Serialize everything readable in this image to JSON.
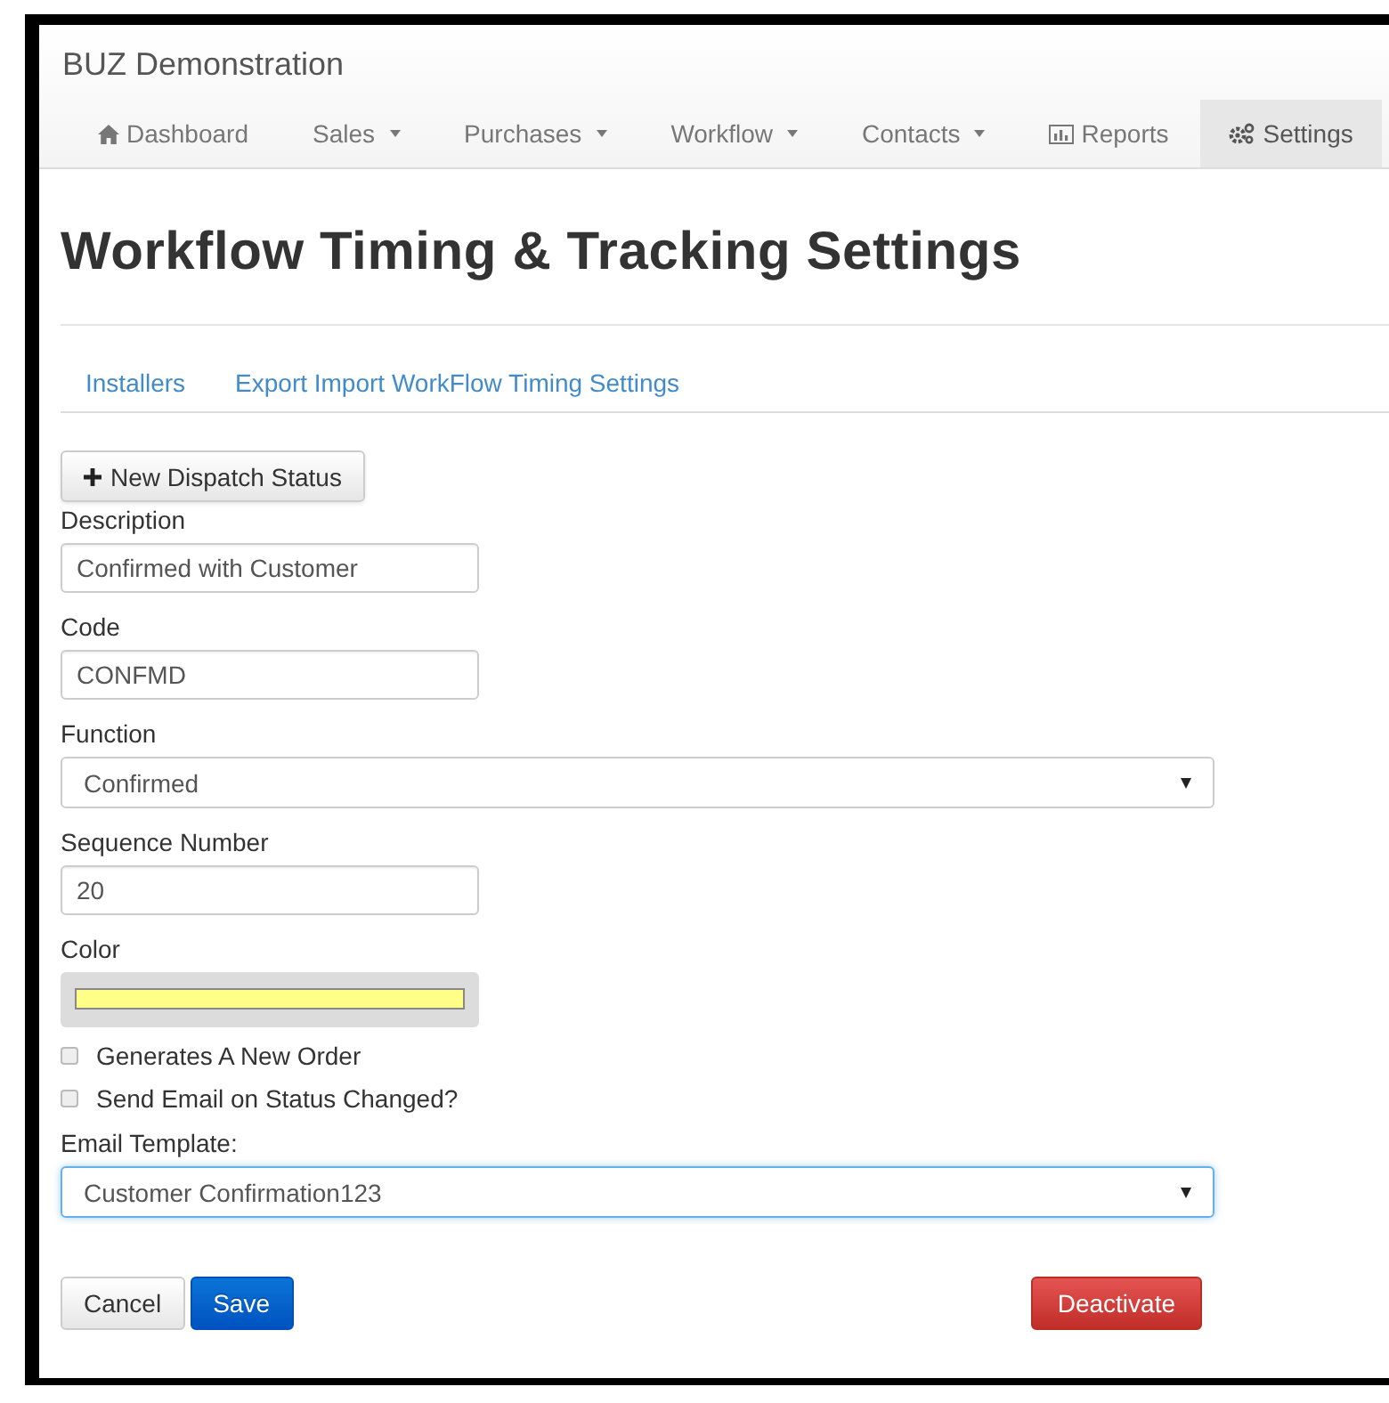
{
  "brand": "BUZ Demonstration",
  "nav": [
    {
      "label": "Dashboard",
      "kind": "home",
      "dropdown": false,
      "selected": false
    },
    {
      "label": "Sales",
      "dropdown": true,
      "selected": false
    },
    {
      "label": "Purchases",
      "dropdown": true,
      "selected": false
    },
    {
      "label": "Workflow",
      "dropdown": true,
      "selected": false
    },
    {
      "label": "Contacts",
      "dropdown": true,
      "selected": false
    },
    {
      "label": "Reports",
      "kind": "chart",
      "dropdown": false,
      "selected": false
    },
    {
      "label": "Settings",
      "kind": "gears",
      "dropdown": false,
      "selected": true
    }
  ],
  "title": "Workflow Timing & Tracking Settings",
  "links": [
    "Installers",
    "Export Import WorkFlow Timing Settings"
  ],
  "new_button": "New Dispatch Status",
  "fields": [
    {
      "kind": "text",
      "label": "Description",
      "value": "Confirmed with Customer"
    },
    {
      "kind": "text",
      "label": "Code",
      "value": "CONFMD"
    },
    {
      "kind": "select",
      "label": "Function",
      "value": "Confirmed",
      "focused": false
    },
    {
      "kind": "text",
      "label": "Sequence Number",
      "value": "20"
    },
    {
      "kind": "color",
      "label": "Color",
      "color": "#ffff88"
    },
    {
      "kind": "checkbox",
      "label": "Generates A New Order",
      "checked": false
    },
    {
      "kind": "checkbox",
      "label": "Send Email on Status Changed?",
      "checked": false
    },
    {
      "kind": "select",
      "label": "Email Template:",
      "value": "Customer Confirmation123",
      "focused": true
    }
  ],
  "buttons": [
    {
      "label": "Cancel",
      "kind": "default"
    },
    {
      "label": "Save",
      "kind": "primary"
    },
    {
      "label": "Deactivate",
      "kind": "danger"
    }
  ]
}
